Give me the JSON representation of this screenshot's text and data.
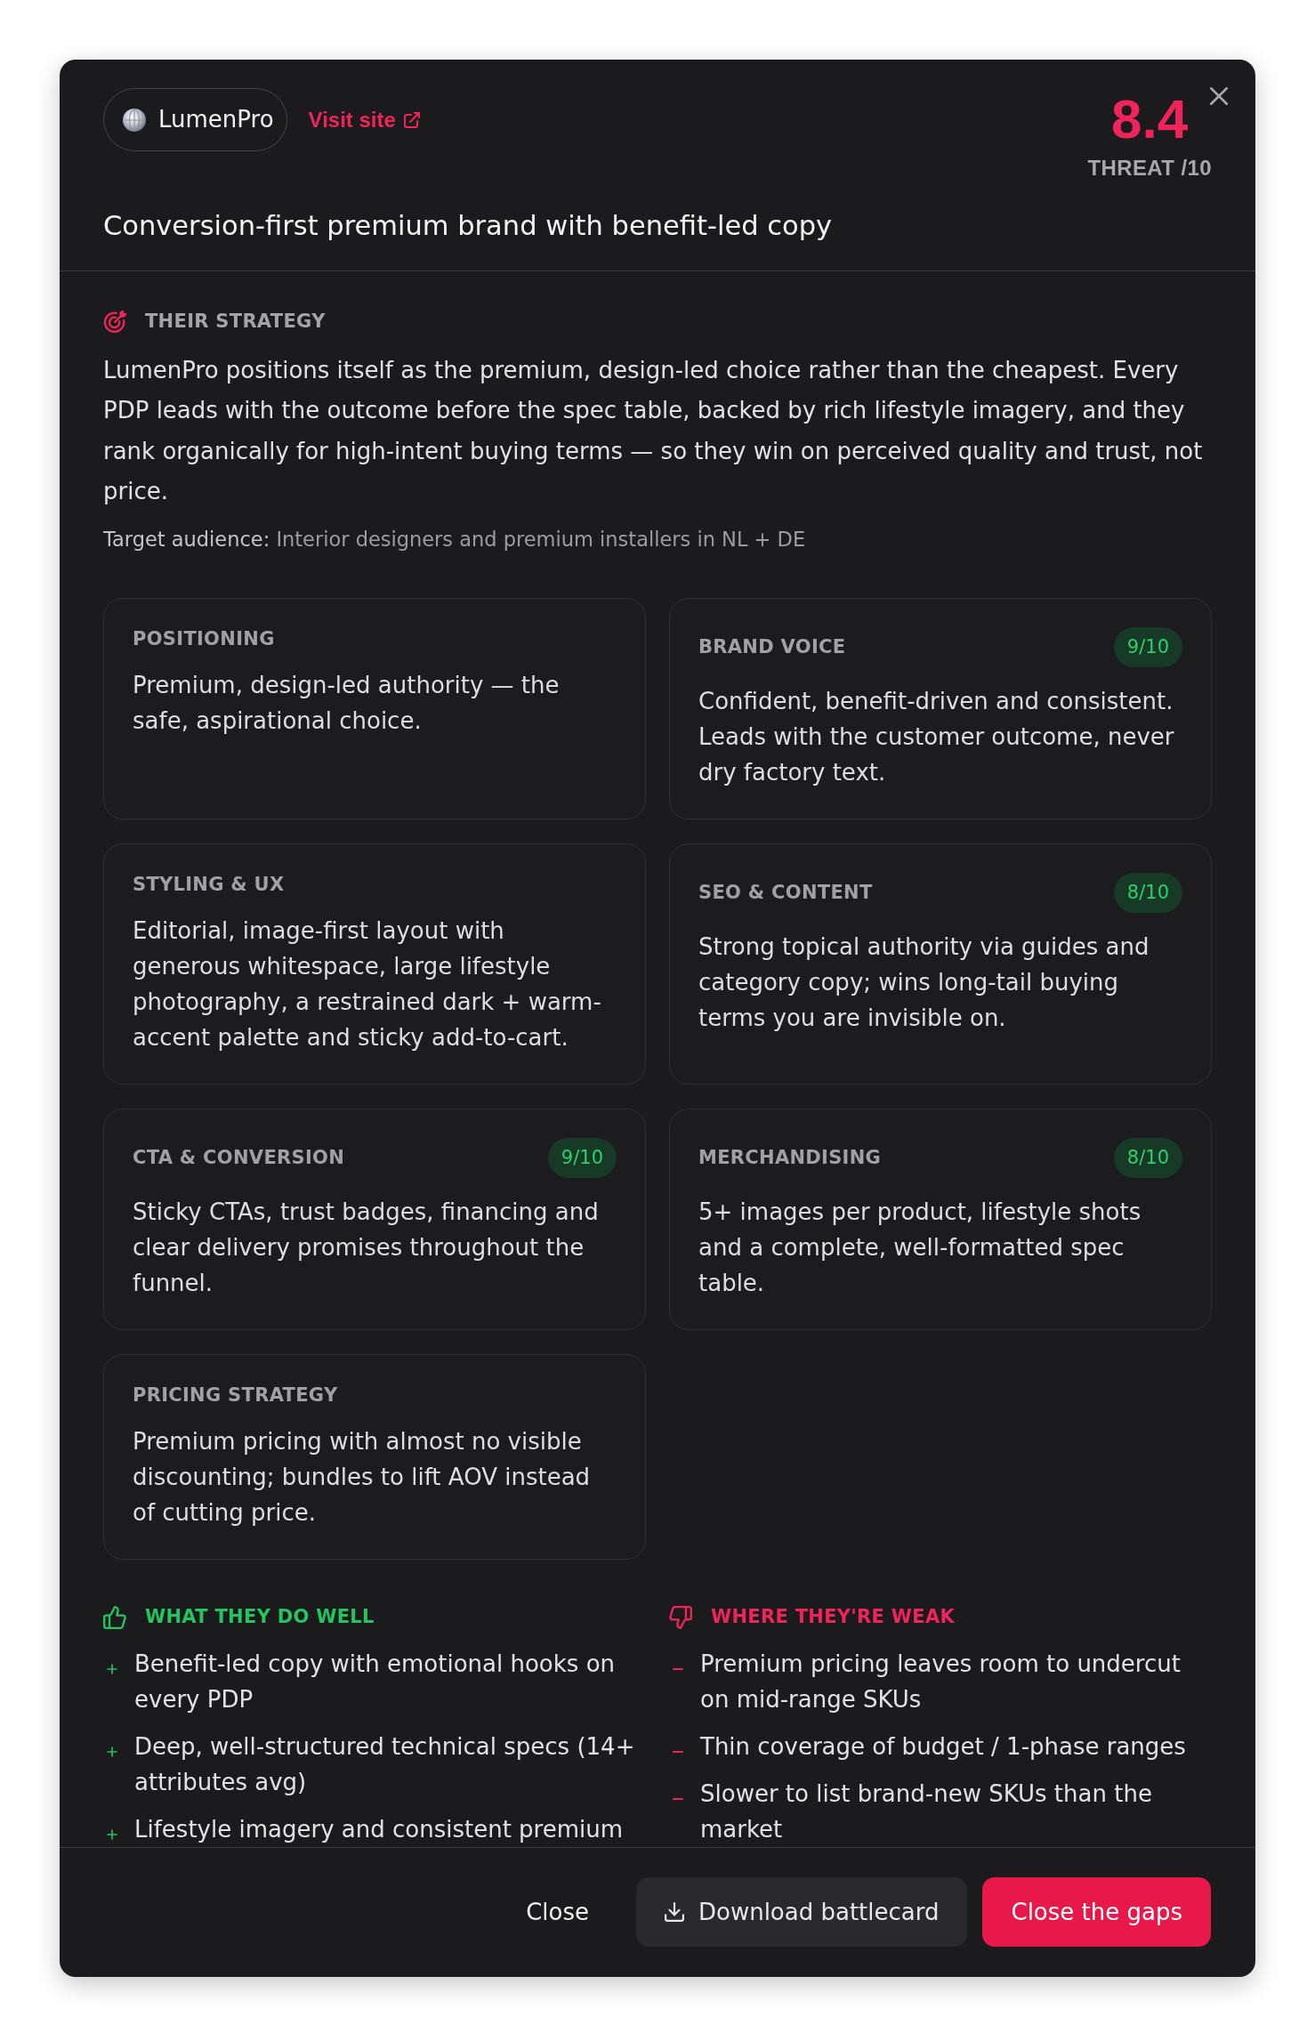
{
  "competitor": {
    "name": "LumenPro",
    "visit_link": "Visit site"
  },
  "threat": {
    "score": "8.4",
    "label": "THREAT /10"
  },
  "headline": "Conversion-first premium brand with benefit-led copy",
  "strategy": {
    "heading": "THEIR STRATEGY",
    "text": "LumenPro positions itself as the premium, design-led choice rather than the cheapest. Every PDP leads with the outcome before the spec table, backed by rich lifestyle imagery, and they rank organically for high-intent buying terms — so they win on perceived quality and trust, not price.",
    "audience": "**Target audience:** Interior designers and premium installers in NL + DE"
  },
  "cards": [
    {
      "title": "POSITIONING",
      "text": "Premium, design-led authority — the safe, aspirational choice."
    },
    {
      "title": "BRAND VOICE",
      "score": "9/10",
      "text": "Confident, benefit-driven and consistent. Leads with the customer outcome, never dry factory text."
    },
    {
      "title": "STYLING & UX",
      "text": "Editorial, image-first layout with generous whitespace, large lifestyle photography, a restrained dark + warm-accent palette and sticky add-to-cart."
    },
    {
      "title": "SEO & CONTENT",
      "score": "8/10",
      "text": "Strong topical authority via guides and category copy; wins long-tail buying terms you are invisible on."
    },
    {
      "title": "CTA & CONVERSION",
      "score": "9/10",
      "text": "Sticky CTAs, trust badges, financing and clear delivery promises throughout the funnel."
    },
    {
      "title": "MERCHANDISING",
      "score": "8/10",
      "text": "5+ images per product, lifestyle shots and a complete, well-formatted spec table."
    },
    {
      "title": "PRICING STRATEGY",
      "text": "Premium pricing with almost no visible discounting; bundles to lift AOV instead of cutting price."
    }
  ],
  "verdicts": [
    {
      "kind": "strengths",
      "heading": "WHAT THEY DO WELL",
      "items": [
        "Benefit-led copy with emotional hooks on every PDP",
        "Deep, well-structured technical specs (14+ attributes avg)",
        "Lifestyle imagery and consistent premium"
      ]
    },
    {
      "kind": "weaknesses",
      "heading": "WHERE THEY'RE WEAK",
      "items": [
        "Premium pricing leaves room to undercut on mid-range SKUs",
        "Thin coverage of budget / 1-phase ranges",
        "Slower to list brand-new SKUs than the market"
      ]
    }
  ],
  "actions": [
    {
      "kind": "dismiss",
      "label": "Close"
    },
    {
      "kind": "download",
      "label": "Download battlecard"
    },
    {
      "kind": "primary",
      "label": "Close the gaps"
    }
  ]
}
